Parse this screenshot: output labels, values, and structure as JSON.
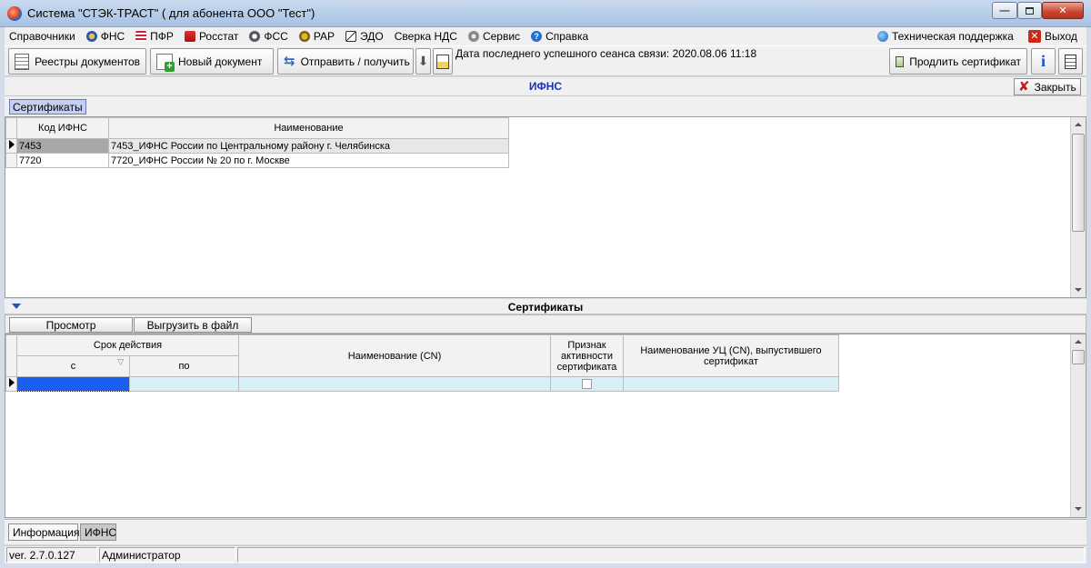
{
  "window": {
    "title": "Система \"СТЭК-ТРАСТ\" ( для абонента ООО \"Тест\")"
  },
  "menu": {
    "items": [
      {
        "label": "Справочники",
        "icon": "none"
      },
      {
        "label": "ФНС",
        "icon": "fns-icon"
      },
      {
        "label": "ПФР",
        "icon": "pfr-icon"
      },
      {
        "label": "Росстат",
        "icon": "rosstat-icon"
      },
      {
        "label": "ФСС",
        "icon": "fss-icon"
      },
      {
        "label": "РАР",
        "icon": "rar-icon"
      },
      {
        "label": "ЭДО",
        "icon": "edo-icon"
      },
      {
        "label": "Сверка НДС",
        "icon": "none"
      },
      {
        "label": "Сервис",
        "icon": "gear-icon"
      },
      {
        "label": "Справка",
        "icon": "help-icon"
      }
    ],
    "support_label": "Техническая поддержка",
    "exit_label": "Выход"
  },
  "toolbar": {
    "registries_label": "Реестры документов",
    "new_doc_label": "Новый документ",
    "send_receive_label": "Отправить / получить",
    "last_session_text": "Дата последнего успешного сеанса связи: 2020.08.06 11:18",
    "renew_cert_label": "Продлить сертификат"
  },
  "panel": {
    "title": "ИФНС",
    "close_label": "Закрыть",
    "tab_label": "Сертификаты"
  },
  "ifns_grid": {
    "columns": [
      "Код ИФНС",
      "Наименование"
    ],
    "rows": [
      {
        "code": "7453",
        "name": "7453_ИФНС России по Центральному району г. Челябинска"
      },
      {
        "code": "7720",
        "name": "7720_ИФНС России № 20 по г. Москве"
      }
    ]
  },
  "certificates": {
    "title": "Сертификаты",
    "view_label": "Просмотр",
    "export_label": "Выгрузить в файл",
    "col_validity": "Срок действия",
    "col_from": "с",
    "col_to": "по",
    "col_cn": "Наименование (CN)",
    "col_active": "Признак активности сертификата",
    "col_issuer": "Наименование УЦ (CN), выпустившего сертификат"
  },
  "bottom_tabs": [
    "Информация",
    "ИФНС"
  ],
  "status": {
    "version": "ver. 2.7.0.127",
    "user": "Администратор"
  }
}
